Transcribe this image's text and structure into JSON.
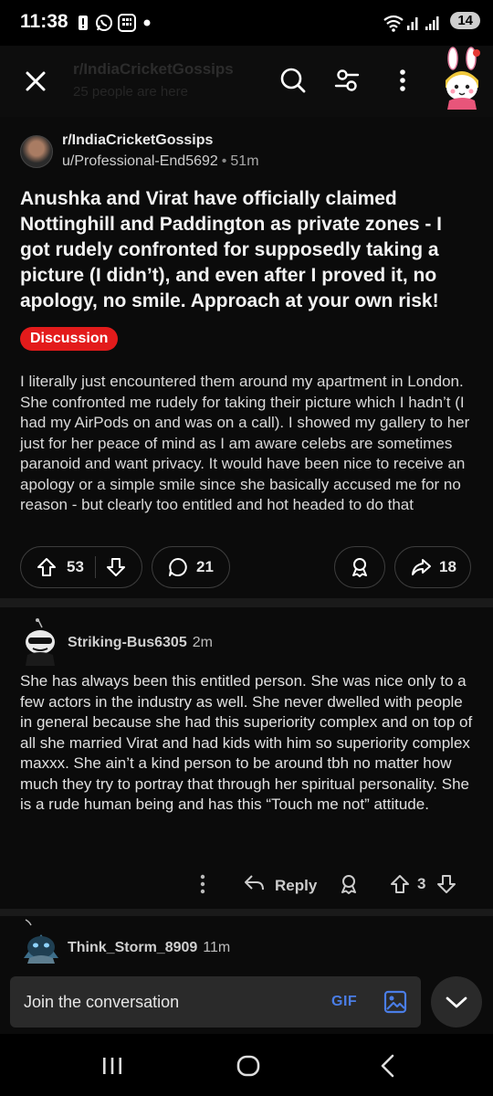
{
  "status_bar": {
    "time": "11:38",
    "battery": "14",
    "icons": [
      "alert-icon",
      "whatsapp-icon",
      "keypad-icon",
      "dot-icon",
      "wifi-icon",
      "signal-icon",
      "signal-icon"
    ]
  },
  "top_bar": {
    "community": "r/IndiaCricketGossips",
    "online": "25 people are here",
    "icons": [
      "close-icon",
      "search-icon",
      "filter-icon",
      "more-icon",
      "user-avatar"
    ]
  },
  "post": {
    "subreddit": "r/IndiaCricketGossips",
    "author": "u/Professional-End5692",
    "separator": "•",
    "age": "51m",
    "title": "Anushka and Virat have officially claimed Nottinghill and Paddington as private zones - I got rudely confronted for supposedly taking a picture (I didn’t), and even after I proved it, no apology, no smile. Approach at your own risk!",
    "flair": "Discussion",
    "flair_color": "#e31b1b",
    "body": "I literally just encountered them around my apartment in London. She confronted me rudely for taking their picture which I hadn’t (I had my AirPods on and was on a call). I showed my gallery to her just for her peace of mind as I am aware celebs are sometimes paranoid and want privacy. It would have been nice to receive an apology or a simple smile since she basically accused me for no reason - but clearly too entitled and hot headed to do that",
    "votes": "53",
    "comments": "21",
    "shares": "18"
  },
  "comment": {
    "author": "Striking-Bus6305",
    "age": "2m",
    "body": "She has always been this entitled person. She was nice only to a few actors in the industry as well. She never dwelled with people in general because she had this superiority complex and on top of all she married Virat and had kids with him so superiority complex maxxx. She ain’t a kind person to be around tbh no matter how much they try to portray that through her spiritual personality. She is a rude human being and has this “Touch me not” attitude.",
    "reply_label": "Reply",
    "votes": "3"
  },
  "comment2": {
    "author": "Think_Storm_8909",
    "age": "11m"
  },
  "composer": {
    "placeholder": "Join the conversation",
    "gif_label": "GIF",
    "accent": "#4a7de6"
  },
  "nav": {
    "icons": [
      "recents-icon",
      "home-icon",
      "back-icon"
    ]
  }
}
